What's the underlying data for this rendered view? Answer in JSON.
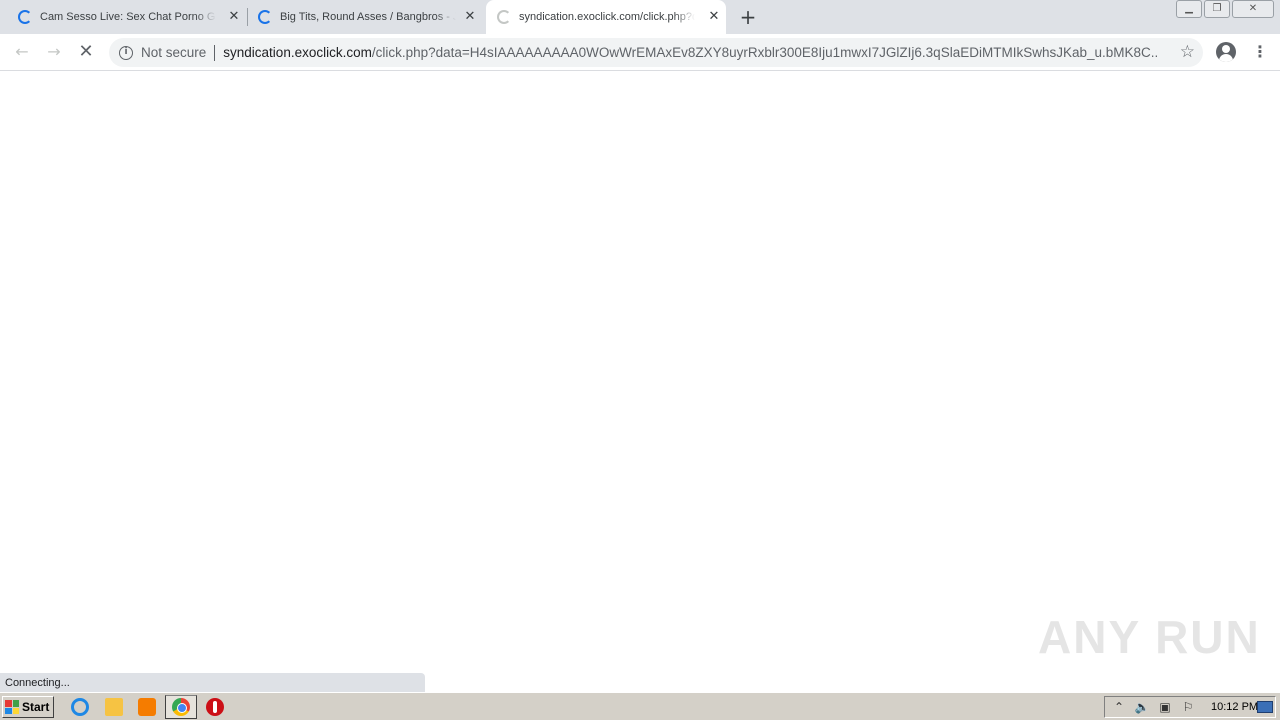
{
  "browser": {
    "tabs": [
      {
        "title": "Cam Sesso Live: Sex Chat Porno Gratis",
        "state": "loading"
      },
      {
        "title": "Big Tits, Round Asses / Bangbros - Jada",
        "state": "loading"
      },
      {
        "title": "syndication.exoclick.com/click.php?data=",
        "state": "loading",
        "active": true
      }
    ],
    "new_tab_label": "+",
    "security_label": "Not secure",
    "url_host": "syndication.exoclick.com",
    "url_path": "/click.php?data=H4sIAAAAAAAAA0WOwWrEMAxEv8ZXY8uyrRxblr300E8Iju1mwxI7JGlZIj6.3qSlaEDiMTMIkSwhsJKab_u.bMK8C...",
    "status_text": "Connecting..."
  },
  "watermark": "ANY RUN",
  "taskbar": {
    "start_label": "Start",
    "clock": "10:12 PM"
  },
  "colors": {
    "tab_strip": "#dee1e6",
    "spinner": "#1a73e8",
    "taskbar": "#d4d0c8"
  }
}
